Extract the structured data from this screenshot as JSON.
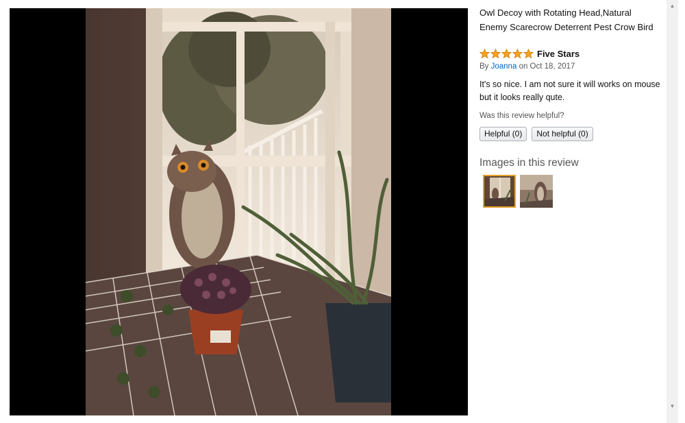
{
  "product": {
    "title_line1": "Owl Decoy with Rotating Head,Natural",
    "title_line2": "Enemy Scarecrow Deterrent Pest Crow Bird"
  },
  "review": {
    "rating": 5,
    "rating_max": 5,
    "title": "Five Stars",
    "by_prefix": "By",
    "author": "Joanna",
    "date": "on Oct 18, 2017",
    "body": "It's so nice. I am not sure it will works on mouse but it looks really qute."
  },
  "helpful": {
    "question": "Was this review helpful?",
    "helpful_label": "Helpful (0)",
    "not_helpful_label": "Not helpful (0)"
  },
  "images": {
    "heading": "Images in this review",
    "count": 2,
    "selected_index": 0
  },
  "colors": {
    "star": "#f6a21c",
    "link": "#0066c0",
    "selected_border": "#e6a127",
    "viewer_background": "#000000"
  },
  "scrollbar": {
    "up_icon": "arrow-up-icon",
    "down_icon": "arrow-down-icon"
  }
}
